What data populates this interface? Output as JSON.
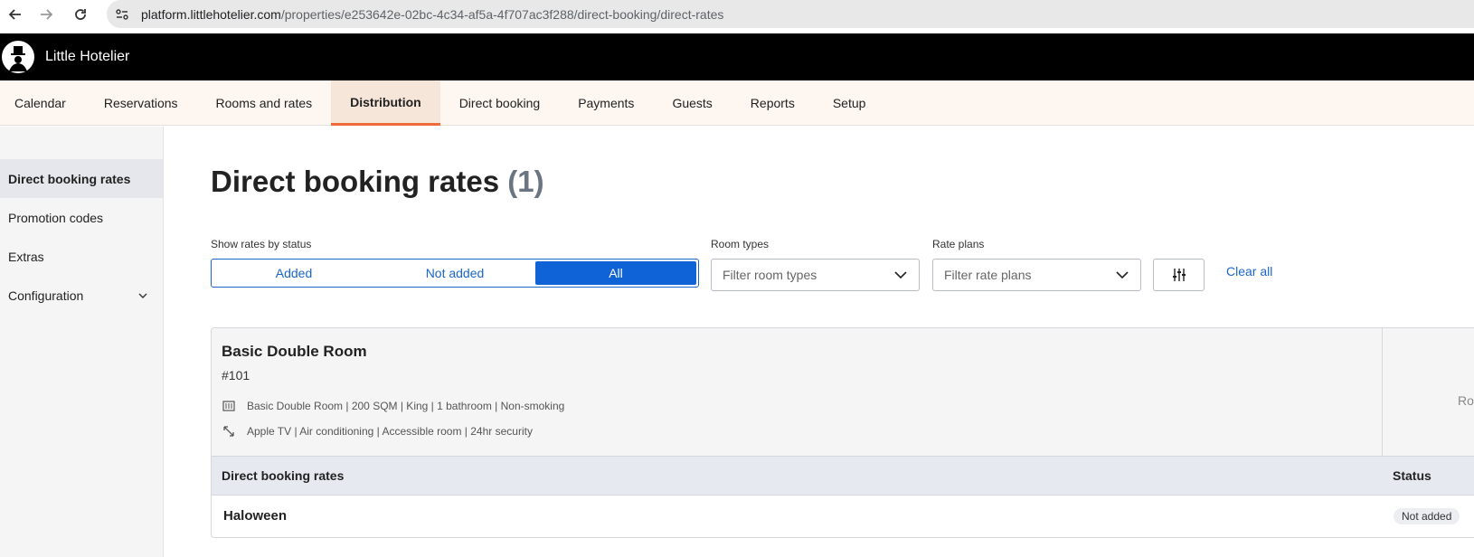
{
  "browser": {
    "url_host": "platform.littlehotelier.com",
    "url_path": "/properties/e253642e-02bc-4c34-af5a-4f707ac3f288/direct-booking/direct-rates"
  },
  "app": {
    "title": "Little Hotelier"
  },
  "main_nav": {
    "tabs": [
      {
        "label": "Calendar"
      },
      {
        "label": "Reservations"
      },
      {
        "label": "Rooms and rates"
      },
      {
        "label": "Distribution",
        "active": true
      },
      {
        "label": "Direct booking"
      },
      {
        "label": "Payments"
      },
      {
        "label": "Guests"
      },
      {
        "label": "Reports"
      },
      {
        "label": "Setup"
      }
    ]
  },
  "sidebar": {
    "items": [
      {
        "label": "Direct booking rates",
        "active": true
      },
      {
        "label": "Promotion codes"
      },
      {
        "label": "Extras"
      },
      {
        "label": "Configuration",
        "expandable": true
      }
    ]
  },
  "page": {
    "title": "Direct booking rates",
    "count": "(1)"
  },
  "filters": {
    "status_label": "Show rates by status",
    "status_options": [
      "Added",
      "Not added",
      "All"
    ],
    "status_selected": "All",
    "room_types_label": "Room types",
    "room_types_placeholder": "Filter room types",
    "rate_plans_label": "Rate plans",
    "rate_plans_placeholder": "Filter rate plans",
    "clear_all": "Clear all"
  },
  "room": {
    "name": "Basic Double Room",
    "number": "#101",
    "details": "Basic Double Room | 200 SQM | King | 1 bathroom | Non-smoking",
    "amenities": "Apple TV | Air conditioning | Accessible room | 24hr security",
    "side_column_text": "Ro",
    "rates_header": "Direct booking rates",
    "status_header": "Status",
    "rates": [
      {
        "name": "Haloween",
        "status": "Not added"
      }
    ]
  },
  "colors": {
    "accent": "#0f63d6",
    "active_tab_underline": "#ef6a3a",
    "header_bg": "#000000"
  }
}
